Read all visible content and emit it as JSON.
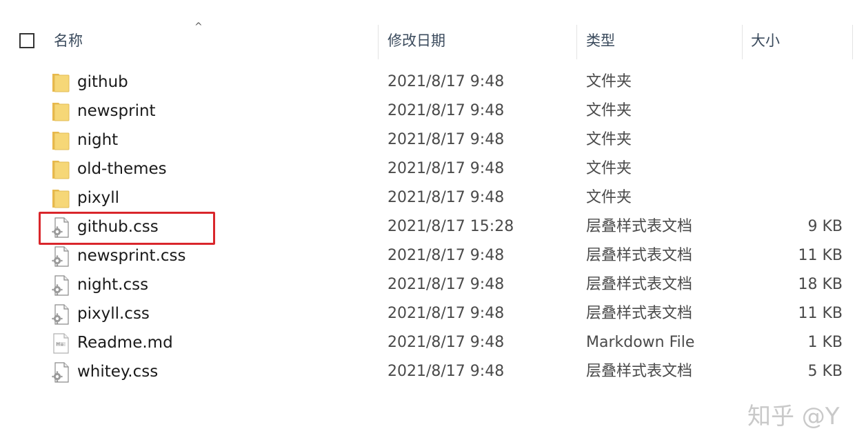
{
  "header": {
    "sort_arrow": "^",
    "col_name": "名称",
    "col_date": "修改日期",
    "col_type": "类型",
    "col_size": "大小"
  },
  "files": [
    {
      "name": "github",
      "date": "2021/8/17 9:48",
      "type": "文件夹",
      "size": "",
      "icon": "folder-icon"
    },
    {
      "name": "newsprint",
      "date": "2021/8/17 9:48",
      "type": "文件夹",
      "size": "",
      "icon": "folder-icon"
    },
    {
      "name": "night",
      "date": "2021/8/17 9:48",
      "type": "文件夹",
      "size": "",
      "icon": "folder-icon"
    },
    {
      "name": "old-themes",
      "date": "2021/8/17 9:48",
      "type": "文件夹",
      "size": "",
      "icon": "folder-icon"
    },
    {
      "name": "pixyll",
      "date": "2021/8/17 9:48",
      "type": "文件夹",
      "size": "",
      "icon": "folder-icon"
    },
    {
      "name": "github.css",
      "date": "2021/8/17 15:28",
      "type": "层叠样式表文档",
      "size": "9 KB",
      "icon": "css-file-icon"
    },
    {
      "name": "newsprint.css",
      "date": "2021/8/17 9:48",
      "type": "层叠样式表文档",
      "size": "11 KB",
      "icon": "css-file-icon"
    },
    {
      "name": "night.css",
      "date": "2021/8/17 9:48",
      "type": "层叠样式表文档",
      "size": "18 KB",
      "icon": "css-file-icon"
    },
    {
      "name": "pixyll.css",
      "date": "2021/8/17 9:48",
      "type": "层叠样式表文档",
      "size": "11 KB",
      "icon": "css-file-icon"
    },
    {
      "name": "Readme.md",
      "date": "2021/8/17 9:48",
      "type": "Markdown File",
      "size": "1 KB",
      "icon": "markdown-file-icon"
    },
    {
      "name": "whitey.css",
      "date": "2021/8/17 9:48",
      "type": "层叠样式表文档",
      "size": "5 KB",
      "icon": "css-file-icon"
    }
  ],
  "watermark": "知乎 @Y",
  "colors": {
    "highlight": "#d9262b",
    "folder": "#f6d777",
    "header_text": "#3a4a5c"
  }
}
